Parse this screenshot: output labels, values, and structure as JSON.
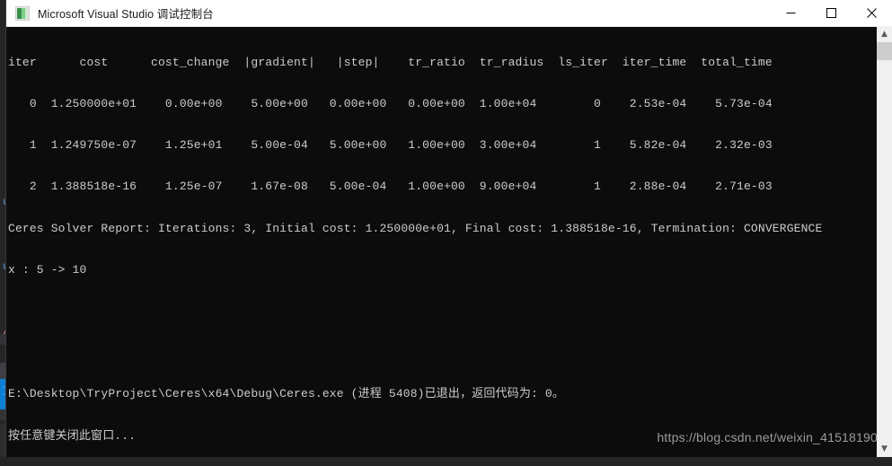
{
  "window": {
    "title": "Microsoft Visual Studio 调试控制台",
    "icon": "console-app-icon",
    "controls": {
      "minimize": "—",
      "maximize": "□",
      "close": "✕"
    }
  },
  "console": {
    "background_color": "#0c0c0c",
    "text_color": "#cccccc",
    "lines": [
      "iter      cost      cost_change  |gradient|   |step|    tr_ratio  tr_radius  ls_iter  iter_time  total_time",
      "   0  1.250000e+01    0.00e+00    5.00e+00   0.00e+00   0.00e+00  1.00e+04        0    2.53e-04    5.73e-04",
      "   1  1.249750e-07    1.25e+01    5.00e-04   5.00e+00   1.00e+00  3.00e+04        1    5.82e-04    2.32e-03",
      "   2  1.388518e-16    1.25e-07    1.67e-08   5.00e-04   1.00e+00  9.00e+04        1    2.88e-04    2.71e-03",
      "Ceres Solver Report: Iterations: 3, Initial cost: 1.250000e+01, Final cost: 1.388518e-16, Termination: CONVERGENCE",
      "x : 5 -> 10",
      "",
      "E:\\Desktop\\TryProject\\Ceres\\x64\\Debug\\Ceres.exe (进程 5408)已退出，返回代码为: 0。",
      "按任意键关闭此窗口..."
    ]
  },
  "scrollbar": {
    "up_arrow": "▲",
    "down_arrow": "▼"
  },
  "watermark": {
    "text": "https://blog.csdn.net/weixin_41518190"
  },
  "background_editor": {
    "code_fragments": [
      "u",
      "u",
      "/",
      "("
    ]
  }
}
